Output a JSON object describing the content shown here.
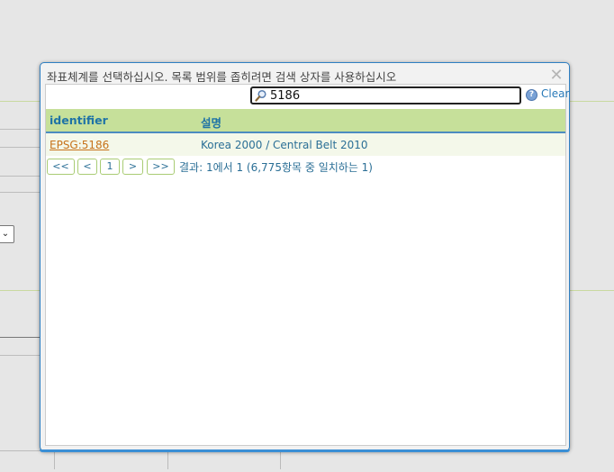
{
  "dialog": {
    "title": "좌표체계를 선택하십시오. 목록 범위를 좁히려면 검색 상자를 사용하십시오",
    "close_icon": "close-x-icon"
  },
  "search": {
    "value": "5186",
    "icon": "magnifier-icon",
    "help_icon": "question-circle-icon",
    "help_glyph": "?",
    "clear_label": "Clear"
  },
  "table": {
    "columns": [
      "identifier",
      "설명"
    ],
    "rows": [
      {
        "identifier": "EPSG:5186",
        "description": "Korea 2000 / Central Belt 2010"
      }
    ]
  },
  "pager": {
    "first": "<<",
    "prev": "<",
    "page": "1",
    "next": ">",
    "last": ">>",
    "info": "결과: 1에서 1 (6,775항목 중 일치하는 1)"
  },
  "background": {
    "select_arrow": "⌄"
  },
  "colors": {
    "header_bg": "#c6e09a",
    "link": "#c7721a",
    "text_blue": "#2b6f96",
    "dialog_border": "#2f7fc2"
  }
}
